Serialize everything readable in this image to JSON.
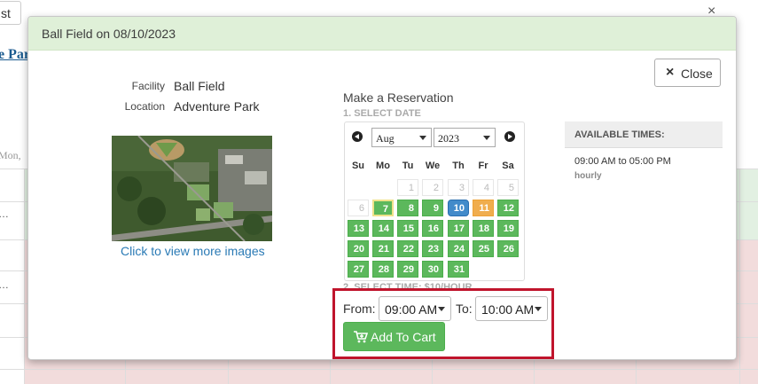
{
  "background": {
    "button_label": "st",
    "close_glyph": "×",
    "link_text": "e Par",
    "mon_label": "Mon,",
    "row_dots": [
      "…",
      "…"
    ]
  },
  "modal": {
    "title": "Ball Field on 08/10/2023",
    "close_label": "Close",
    "close_icon": "×",
    "facility_label": "Facility",
    "facility_value": "Ball Field",
    "location_label": "Location",
    "location_value": "Adventure Park",
    "more_images_link": "Click to view more images",
    "reservation_title": "Make a Reservation",
    "step1_label": "1. SELECT DATE",
    "step2_label": "2. SELECT TIME: $10/HOUR"
  },
  "calendar": {
    "month": "Aug",
    "year": "2023",
    "weekdays": [
      "Su",
      "Mo",
      "Tu",
      "We",
      "Th",
      "Fr",
      "Sa"
    ],
    "weeks": [
      [
        {
          "d": "",
          "s": "empty"
        },
        {
          "d": "",
          "s": "empty"
        },
        {
          "d": "1",
          "s": "disabled"
        },
        {
          "d": "2",
          "s": "disabled"
        },
        {
          "d": "3",
          "s": "disabled"
        },
        {
          "d": "4",
          "s": "disabled"
        },
        {
          "d": "5",
          "s": "disabled"
        }
      ],
      [
        {
          "d": "6",
          "s": "disabled"
        },
        {
          "d": "7",
          "s": "today"
        },
        {
          "d": "8",
          "s": "avail"
        },
        {
          "d": "9",
          "s": "avail"
        },
        {
          "d": "10",
          "s": "selected"
        },
        {
          "d": "11",
          "s": "highlight"
        },
        {
          "d": "12",
          "s": "avail"
        }
      ],
      [
        {
          "d": "13",
          "s": "avail"
        },
        {
          "d": "14",
          "s": "avail"
        },
        {
          "d": "15",
          "s": "avail"
        },
        {
          "d": "16",
          "s": "avail"
        },
        {
          "d": "17",
          "s": "avail"
        },
        {
          "d": "18",
          "s": "avail"
        },
        {
          "d": "19",
          "s": "avail"
        }
      ],
      [
        {
          "d": "20",
          "s": "avail"
        },
        {
          "d": "21",
          "s": "avail"
        },
        {
          "d": "22",
          "s": "avail"
        },
        {
          "d": "23",
          "s": "avail"
        },
        {
          "d": "24",
          "s": "avail"
        },
        {
          "d": "25",
          "s": "avail"
        },
        {
          "d": "26",
          "s": "avail"
        }
      ],
      [
        {
          "d": "27",
          "s": "avail"
        },
        {
          "d": "28",
          "s": "avail"
        },
        {
          "d": "29",
          "s": "avail"
        },
        {
          "d": "30",
          "s": "avail"
        },
        {
          "d": "31",
          "s": "avail"
        },
        {
          "d": "",
          "s": "empty"
        },
        {
          "d": "",
          "s": "empty"
        }
      ]
    ]
  },
  "available": {
    "header": "AVAILABLE TIMES:",
    "time_range": "09:00 AM to 05:00 PM",
    "rate": "hourly"
  },
  "time": {
    "from_label": "From:",
    "from_value": "09:00 AM",
    "to_label": "To:",
    "to_value": "10:00 AM",
    "add_to_cart_label": "Add To Cart"
  },
  "colors": {
    "header_green": "#dff0d8",
    "available_green": "#5cb85c",
    "selected_blue": "#428bca",
    "highlight_orange": "#f0ad4e",
    "focus_red": "#c0142c"
  }
}
